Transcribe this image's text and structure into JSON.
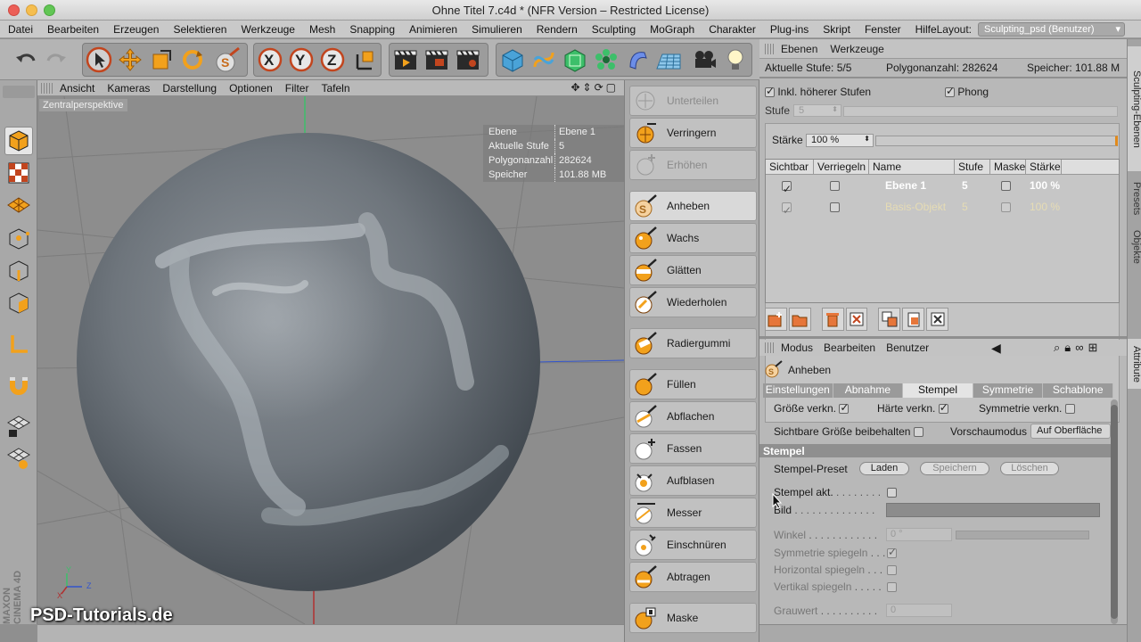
{
  "window": {
    "title": "Ohne Titel 7.c4d * (NFR Version – Restricted License)"
  },
  "menu": {
    "items": [
      "Datei",
      "Bearbeiten",
      "Erzeugen",
      "Selektieren",
      "Werkzeuge",
      "Mesh",
      "Snapping",
      "Animieren",
      "Simulieren",
      "Rendern",
      "Sculpting",
      "MoGraph",
      "Charakter",
      "Plug-ins",
      "Skript",
      "Fenster",
      "Hilfe"
    ],
    "layout_label": "Layout:",
    "layout_value": "Sculpting_psd (Benutzer)"
  },
  "viewport": {
    "menu": [
      "Ansicht",
      "Kameras",
      "Darstellung",
      "Optionen",
      "Filter",
      "Tafeln"
    ],
    "camera_label": "Zentralperspektive",
    "hud": [
      {
        "k": "Ebene",
        "v": "Ebene 1"
      },
      {
        "k": "Aktuelle Stufe",
        "v": "5"
      },
      {
        "k": "Polygonanzahl",
        "v": "282624"
      },
      {
        "k": "Speicher",
        "v": "101.88 MB"
      }
    ],
    "axis": {
      "y": "Y",
      "z": "Z",
      "x": "X"
    },
    "brand": "MAXON CINEMA 4D",
    "watermark": "PSD-Tutorials.de"
  },
  "brushes": [
    {
      "label": "Unterteilen",
      "disabled": true
    },
    {
      "label": "Verringern",
      "disabled": false
    },
    {
      "label": "Erhöhen",
      "disabled": true
    },
    {
      "label": "Anheben",
      "selected": true
    },
    {
      "label": "Wachs"
    },
    {
      "label": "Glätten"
    },
    {
      "label": "Wiederholen"
    },
    {
      "label": "Radiergummi"
    },
    {
      "label": "Füllen"
    },
    {
      "label": "Abflachen"
    },
    {
      "label": "Fassen"
    },
    {
      "label": "Aufblasen"
    },
    {
      "label": "Messer"
    },
    {
      "label": "Einschnüren"
    },
    {
      "label": "Abtragen"
    },
    {
      "label": "Maske"
    }
  ],
  "layers": {
    "tabs": [
      "Ebenen",
      "Werkzeuge"
    ],
    "aktuelle_stufe": "Aktuelle Stufe: 5/5",
    "polygonanzahl": "Polygonanzahl: 282624",
    "speicher": "Speicher: 101.88 M",
    "inkl": "Inkl. höherer Stufen",
    "phong": "Phong",
    "stufe_label": "Stufe",
    "stufe_value": "5",
    "staerke_label": "Stärke",
    "staerke_value": "100 %",
    "columns": [
      "Sichtbar",
      "Verriegeln",
      "Name",
      "Stufe",
      "Maske",
      "Stärke"
    ],
    "rows": [
      {
        "name": "Ebene 1",
        "stufe": "5",
        "staerke": "100 %"
      },
      {
        "name": "Basis-Objekt",
        "stufe": "5",
        "staerke": "100 %"
      }
    ]
  },
  "attr": {
    "menu": [
      "Modus",
      "Bearbeiten",
      "Benutzer"
    ],
    "tool": "Anheben",
    "tabs": [
      "Einstellungen",
      "Abnahme",
      "Stempel",
      "Symmetrie",
      "Schablone"
    ],
    "active_tab": "Stempel",
    "groesse": "Größe verkn.",
    "haerte": "Härte verkn.",
    "symmetrie": "Symmetrie verkn.",
    "sichtbare": "Sichtbare Größe beibehalten",
    "vorschau": "Vorschaumodus",
    "vorschau_value": "Auf Oberfläche",
    "section": "Stempel",
    "preset_label": "Stempel-Preset",
    "laden": "Laden",
    "speichern": "Speichern",
    "loeschen": "Löschen",
    "stempel_akt": "Stempel akt.",
    "bild": "Bild",
    "winkel": "Winkel",
    "winkel_value": "0 °",
    "sym_spiegeln": "Symmetrie spiegeln",
    "hor_spiegeln": "Horizontal spiegeln",
    "vert_spiegeln": "Vertikal spiegeln",
    "grauwert": "Grauwert",
    "grauwert_value": "0"
  },
  "sidetabs": [
    "Sculpting-Ebenen",
    "Presets",
    "Objekte",
    "Attribute"
  ]
}
